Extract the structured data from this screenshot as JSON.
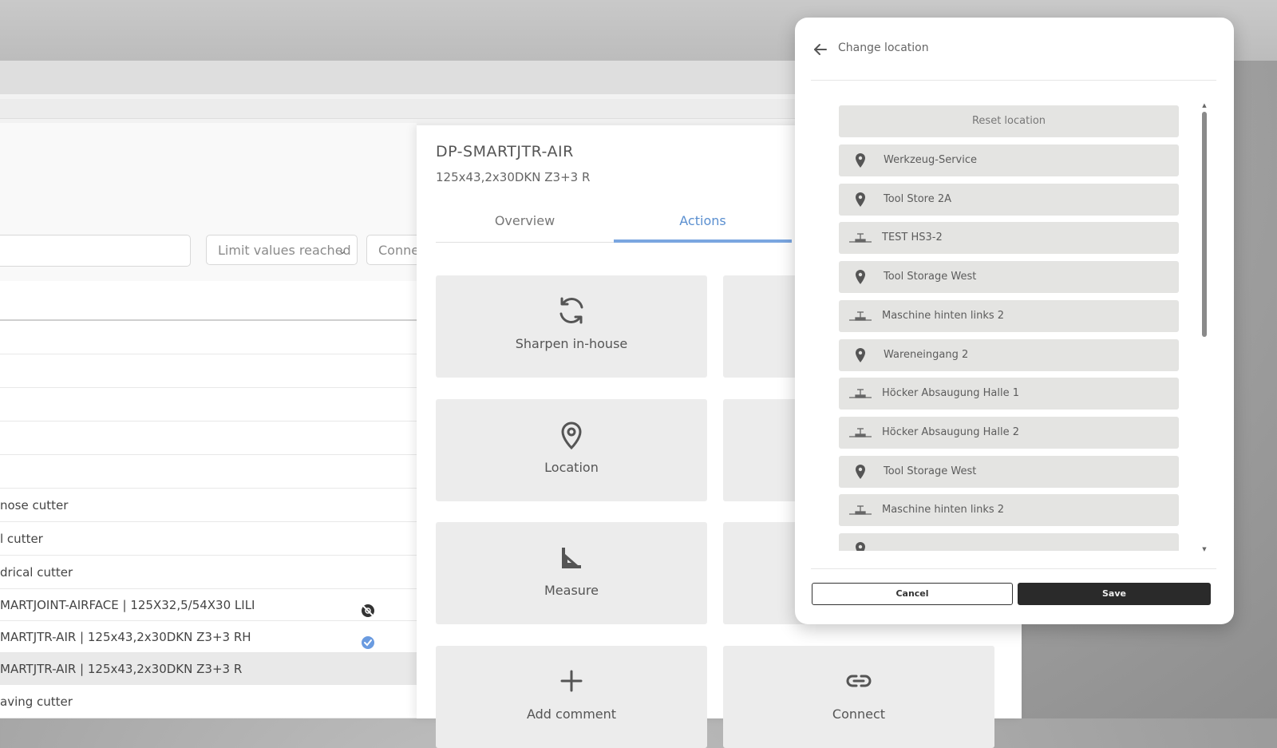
{
  "filters": {
    "limit_select": "Limit values reached",
    "connection_select": "Conne"
  },
  "table_rows": [
    {
      "text": "",
      "status": ""
    },
    {
      "text": "",
      "status": ""
    },
    {
      "text": "",
      "status": ""
    },
    {
      "text": "",
      "status": ""
    },
    {
      "text": "",
      "status": ""
    },
    {
      "text": "nose cutter",
      "status": ""
    },
    {
      "text": "l cutter",
      "status": ""
    },
    {
      "text": "drical cutter",
      "status": ""
    },
    {
      "text": "MARTJOINT-AIRFACE | 125X32,5/54X30 LILI",
      "status": "disconnected"
    },
    {
      "text": "MARTJTR-AIR | 125x43,2x30DKN Z3+3 RH",
      "status": "verified"
    },
    {
      "text": "MARTJTR-AIR | 125x43,2x30DKN Z3+3 R",
      "status": "selected"
    },
    {
      "text": "aving cutter",
      "status": ""
    }
  ],
  "detail": {
    "title": "DP-SMARTJTR-AIR",
    "subtitle": "125x43,2x30DKN Z3+3 R",
    "tabs": [
      {
        "label": "Overview",
        "active": false
      },
      {
        "label": "Actions",
        "active": true
      }
    ],
    "actions": [
      {
        "label": "Sharpen in-house",
        "icon": "refresh-icon"
      },
      {
        "label": "Location",
        "icon": "location-pin-icon"
      },
      {
        "label": "Measure",
        "icon": "set-square-icon"
      },
      {
        "label": "Add comment",
        "icon": "plus-icon"
      },
      {
        "label": "Connect",
        "icon": "link-icon"
      }
    ]
  },
  "modal": {
    "title": "Change location",
    "back_icon": "arrow-left-icon",
    "reset_label": "Reset location",
    "locations": [
      {
        "label": "Werkzeug-Service",
        "icon": "map-pin-icon"
      },
      {
        "label": "Tool Store 2A",
        "icon": "map-pin-icon"
      },
      {
        "label": "TEST HS3-2",
        "icon": "machine-icon"
      },
      {
        "label": "Tool Storage West",
        "icon": "map-pin-icon"
      },
      {
        "label": "Maschine hinten links 2",
        "icon": "machine-icon"
      },
      {
        "label": "Wareneingang 2",
        "icon": "map-pin-icon"
      },
      {
        "label": "Höcker Absaugung Halle 1",
        "icon": "machine-icon"
      },
      {
        "label": "Höcker Absaugung Halle 2",
        "icon": "machine-icon"
      },
      {
        "label": "Tool Storage West",
        "icon": "map-pin-icon"
      },
      {
        "label": "Maschine hinten links 2",
        "icon": "machine-icon"
      },
      {
        "label": "",
        "icon": "map-pin-icon"
      }
    ],
    "cancel_label": "Cancel",
    "save_label": "Save"
  },
  "colors": {
    "accent": "#7aa6e0",
    "verified": "#6a9be0",
    "save_button": "#2a2a2a",
    "list_item_bg": "#e4e4e2"
  }
}
